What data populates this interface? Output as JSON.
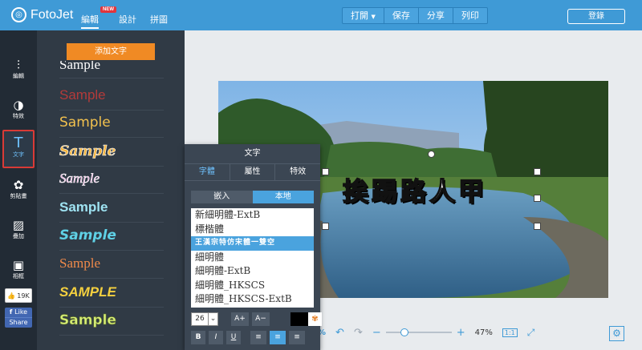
{
  "brand": {
    "name": "FotoJet"
  },
  "nav": {
    "tabs": [
      {
        "label": "編輯"
      },
      {
        "label": "設計"
      },
      {
        "label": "拼圖"
      }
    ],
    "new_badge": "NEW"
  },
  "actions": {
    "open": "打開",
    "save": "保存",
    "share": "分享",
    "print": "列印"
  },
  "login": "登錄",
  "rail": {
    "items": [
      {
        "label": "編輯"
      },
      {
        "label": "特效"
      },
      {
        "label": "文字"
      },
      {
        "label": "剪貼畫"
      },
      {
        "label": "疊加"
      },
      {
        "label": "相框"
      }
    ]
  },
  "social": {
    "likes": "19K",
    "like": "Like",
    "share": "Share"
  },
  "panel": {
    "add_text": "添加文字",
    "samples": [
      "Sample",
      "Sample",
      "Sample",
      "Sample",
      "Sample",
      "Sample",
      "Sample",
      "Sample",
      "SAMPLE",
      "Sample"
    ]
  },
  "canvas": {
    "headline": "挨踢路人甲"
  },
  "zoom": {
    "minus": "−",
    "plus": "+",
    "percent": "47%"
  },
  "text_popup": {
    "title": "文字",
    "tabs": [
      "字體",
      "屬性",
      "特效"
    ],
    "source_embedded": "嵌入",
    "source_local": "本地",
    "fonts": [
      "新細明體-ExtB",
      "標楷體",
      "王漢宗特仿宋體一雙空",
      "細明體",
      "細明體-ExtB",
      "細明體_HKSCS",
      "細明體_HKSCS-ExtB"
    ],
    "font_size": "26",
    "size_up": "A+",
    "size_down": "A−",
    "bold": "B",
    "italic": "I",
    "underline": "U"
  },
  "colors": {
    "topbar": "#3f9ad6",
    "rail": "#222b35",
    "panel": "#303a45",
    "accent": "#f08a24",
    "highlight": "#4aa3de"
  }
}
